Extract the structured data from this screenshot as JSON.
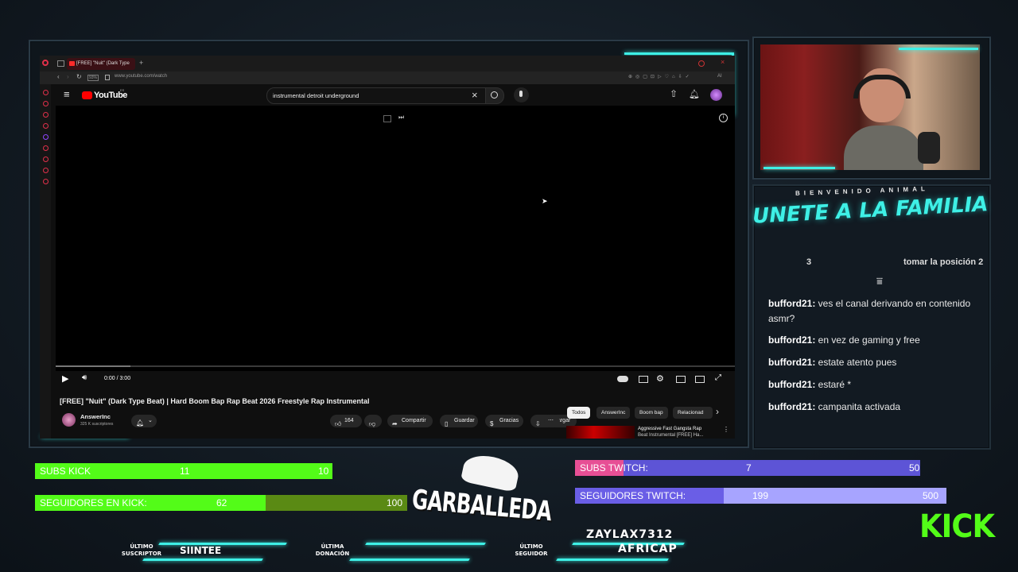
{
  "browser": {
    "tab_title": "[FREE] \"Nuit\" (Dark Type",
    "new_tab": "+",
    "url": "www.youtube.com/watch",
    "addr_badge": "93%",
    "addr_right": "AI"
  },
  "youtube": {
    "logo": "YouTube",
    "logo_sup": "ES",
    "search_value": "instrumental detroit underground",
    "time": "0:00 / 3:00",
    "video_title": "[FREE] \"Nuit\" (Dark Type Beat) | Hard Boom Bap Rap Beat 2026 Freestyle Rap Instrumental",
    "channel_name": "AnswerInc",
    "subscribers": "325 K suscriptores",
    "likes": "164",
    "share": "Compartir",
    "save": "Guardar",
    "thanks": "Gracias",
    "download": "Descargar",
    "chips": [
      "Todos",
      "AnswerInc",
      "Boom bap",
      "Relacionad"
    ],
    "rec_title_1": "Aggressive Fast Gangsta Rap",
    "rec_title_2": "Beat Instrumental [FREE] Ha..."
  },
  "overlay": {
    "welcome": "BIENVENIDO ANIMAL",
    "join": "UNETE A LA FAMILIA",
    "chat_top_left": "3",
    "chat_top_right": "tomar la posición 2",
    "chat": [
      {
        "user": "bufford21:",
        "msg": "ves el canal derivando en contenido asmr?"
      },
      {
        "user": "bufford21:",
        "msg": "en vez de gaming y free"
      },
      {
        "user": "bufford21:",
        "msg": "estate atento pues"
      },
      {
        "user": "bufford21:",
        "msg": "estaré *"
      },
      {
        "user": "bufford21:",
        "msg": "campanita activada"
      }
    ],
    "subs_kick": {
      "label": "SUBS KICK",
      "value": "11",
      "goal": "10",
      "fill_pct": 100
    },
    "followers_kick": {
      "label": "SEGUIDORES EN KICK:",
      "value": "62",
      "goal": "100",
      "fill_pct": 62
    },
    "subs_twitch": {
      "label": "SUBS TWITCH:",
      "value": "7",
      "goal": "50",
      "fill_pct": 14
    },
    "followers_twitch": {
      "label": "SEGUIDORES TWITCH:",
      "value": "199",
      "goal": "500",
      "fill_pct": 40
    },
    "logo_text": "GARBALLEDA",
    "last_sub_label_1": "ÚLTIMO",
    "last_sub_label_2": "SUSCRIPTOR",
    "last_sub_value": "SIINTEE",
    "last_don_label_1": "ÚLTIMA",
    "last_don_label_2": "DONACIÓN",
    "last_don_value": "",
    "last_fol_label_1": "ÚLTIMO",
    "last_fol_label_2": "SEGUIDOR",
    "last_fol_value_1": "ZAYLAX7312",
    "last_fol_value_2": "AFRICAP",
    "kick_logo": "KICK"
  },
  "colors": {
    "kick_green": "#53fc18",
    "kick_dark": "#5a8a14",
    "twitch_purple": "#6a5ee6",
    "twitch_light": "#a7a4ff",
    "neon": "#3ef0e6",
    "yt_red": "#ff0000"
  }
}
